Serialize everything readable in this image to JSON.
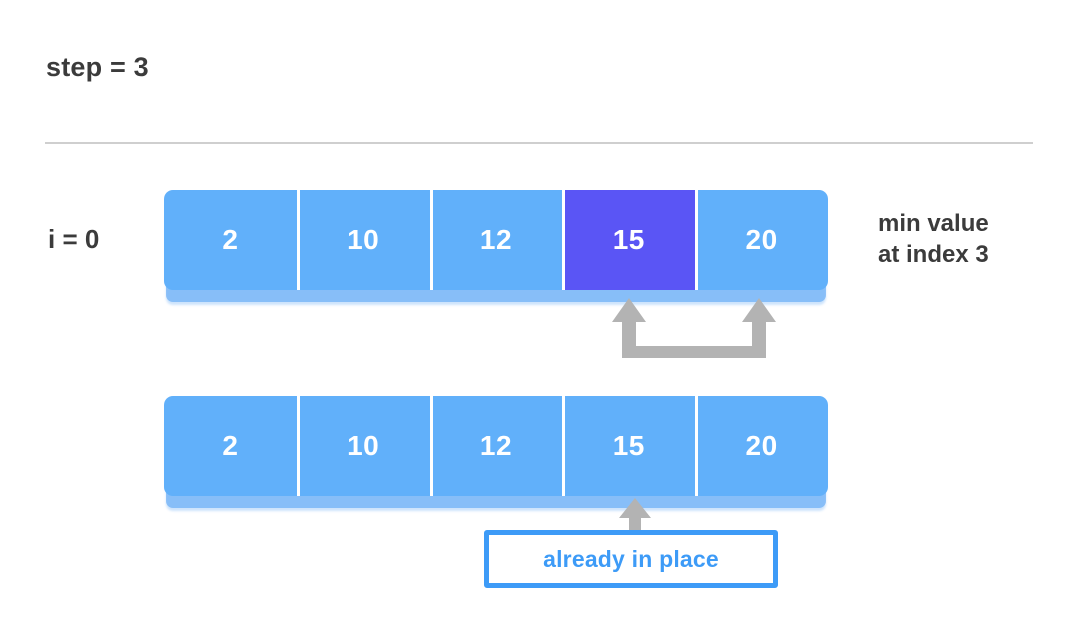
{
  "header": {
    "step_label": "step = 3"
  },
  "top_row": {
    "index_label": "i = 0",
    "cells": [
      {
        "value": "2",
        "highlighted": false
      },
      {
        "value": "10",
        "highlighted": false
      },
      {
        "value": "12",
        "highlighted": false
      },
      {
        "value": "15",
        "highlighted": true
      },
      {
        "value": "20",
        "highlighted": false
      }
    ],
    "side_note_line1": "min value",
    "side_note_line2": "at index 3"
  },
  "bottom_row": {
    "cells": [
      {
        "value": "2",
        "highlighted": false
      },
      {
        "value": "10",
        "highlighted": false
      },
      {
        "value": "12",
        "highlighted": false
      },
      {
        "value": "15",
        "highlighted": false
      },
      {
        "value": "20",
        "highlighted": false
      }
    ]
  },
  "callout": {
    "text": "already in place"
  },
  "colors": {
    "cell_fill": "#61B0FA",
    "cell_highlight": "#5A55F5",
    "cell_text": "#FFFFFF",
    "label_text": "#3B3B3B",
    "divider": "#CFCFCF",
    "connector": "#B3B3B3",
    "callout_border": "#3D9BF7",
    "callout_text": "#3D9BF7",
    "background": "#FFFFFF"
  }
}
